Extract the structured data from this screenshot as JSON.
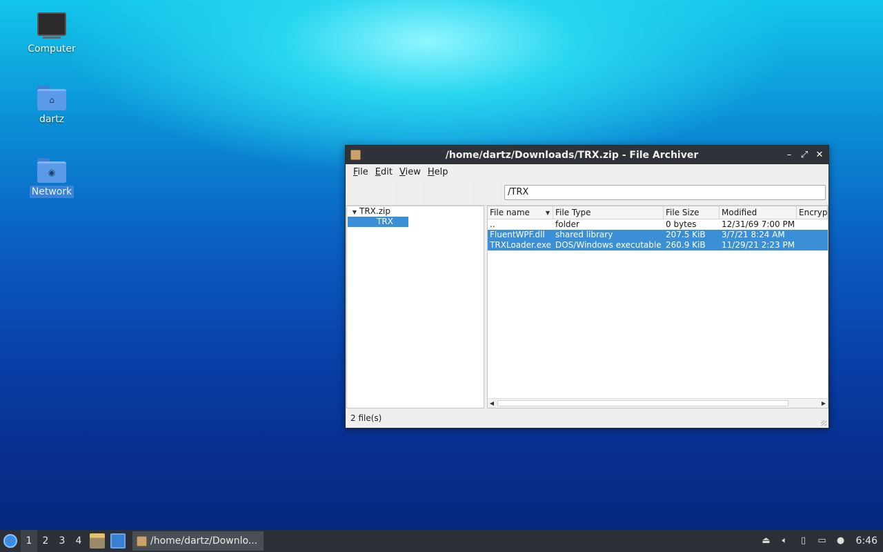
{
  "desktop": {
    "icons": [
      {
        "label": "Computer",
        "icon": "computer-icon"
      },
      {
        "label": "dartz",
        "icon": "home-folder-icon"
      },
      {
        "label": "Network",
        "icon": "network-folder-icon",
        "selected": true
      }
    ]
  },
  "window": {
    "title": "/home/dartz/Downloads/TRX.zip - File Archiver",
    "controls": {
      "minimize": "–",
      "maximize": "⤢",
      "close": "✕"
    },
    "menu": [
      "File",
      "Edit",
      "View",
      "Help"
    ],
    "location": "/TRX",
    "tree": {
      "root": "TRX.zip",
      "child": "TRX"
    },
    "columns": [
      "File name",
      "File Type",
      "File Size",
      "Modified",
      "Encrypt"
    ],
    "rows": [
      {
        "name": "..",
        "type": "folder",
        "size": "0 bytes",
        "modified": "12/31/69 7:00 PM",
        "selected": false
      },
      {
        "name": "FluentWPF.dll",
        "type": "shared library",
        "size": "207.5 KiB",
        "modified": "3/7/21 8:24 AM",
        "selected": true
      },
      {
        "name": "TRXLoader.exe",
        "type": "DOS/Windows executable",
        "size": "260.9 KiB",
        "modified": "11/29/21 2:23 PM",
        "selected": true
      }
    ],
    "status": "2 file(s)"
  },
  "taskbar": {
    "workspaces": [
      "1",
      "2",
      "3",
      "4"
    ],
    "active_workspace": "1",
    "task_label": "/home/dartz/Downlo...",
    "clock": "6:46"
  },
  "colors": {
    "selection": "#3a8fd6",
    "titlebar": "#2f3238",
    "taskbar": "#2d3036"
  }
}
